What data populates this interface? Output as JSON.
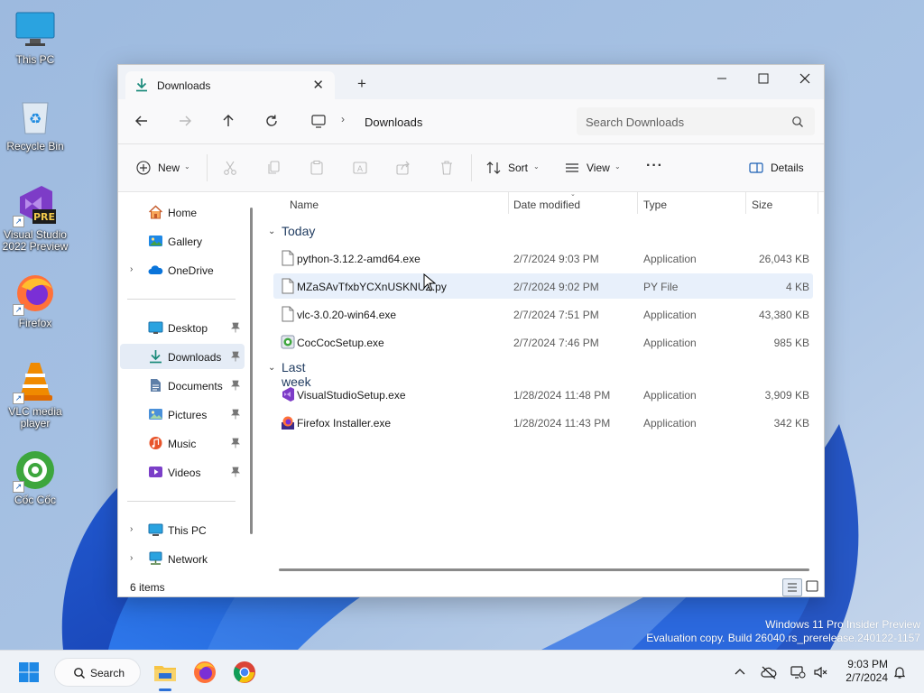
{
  "desktop": {
    "icons": [
      {
        "label": "This PC"
      },
      {
        "label": "Recycle Bin"
      },
      {
        "label": "Visual Studio 2022 Preview",
        "badge": "PRE"
      },
      {
        "label": "Firefox"
      },
      {
        "label": "VLC media player"
      },
      {
        "label": "Cốc Cốc"
      }
    ],
    "watermark": {
      "line1": "Windows 11 Pro Insider Preview",
      "line2": "Evaluation copy. Build 26040.rs_prerelease.240122-1157"
    }
  },
  "window": {
    "tab_title": "Downloads",
    "controls": {
      "minimize": "—",
      "maximize": "☐",
      "close": "✕"
    },
    "new_tab": "+",
    "nav": {
      "back": "←",
      "forward": "→",
      "up": "↑",
      "refresh": "↻"
    },
    "address": {
      "separator": "›",
      "current": "Downloads"
    },
    "search": {
      "placeholder": "Search Downloads"
    },
    "toolbar": {
      "new_label": "New",
      "sort_label": "Sort",
      "view_label": "View",
      "more_label": "···",
      "details_label": "Details"
    },
    "sidebar": {
      "items": [
        {
          "label": "Home",
          "icon": "home-icon"
        },
        {
          "label": "Gallery",
          "icon": "gallery-icon"
        },
        {
          "label": "OneDrive",
          "icon": "onedrive-icon"
        },
        {
          "label": "Desktop",
          "icon": "desktop-folder-icon"
        },
        {
          "label": "Downloads",
          "icon": "downloads-folder-icon"
        },
        {
          "label": "Documents",
          "icon": "documents-folder-icon"
        },
        {
          "label": "Pictures",
          "icon": "pictures-folder-icon"
        },
        {
          "label": "Music",
          "icon": "music-folder-icon"
        },
        {
          "label": "Videos",
          "icon": "videos-folder-icon"
        },
        {
          "label": "This PC",
          "icon": "this-pc-icon"
        },
        {
          "label": "Network",
          "icon": "network-icon"
        }
      ]
    },
    "columns": {
      "name": "Name",
      "date": "Date modified",
      "type": "Type",
      "size": "Size"
    },
    "groups": [
      {
        "label": "Today",
        "files": [
          {
            "name": "python-3.12.2-amd64.exe",
            "date": "2/7/2024 9:03 PM",
            "type": "Application",
            "size": "26,043 KB",
            "icon": "generic-file-icon"
          },
          {
            "name": "MZaSAvTfxbYCXnUSKNUZ.py",
            "date": "2/7/2024 9:02 PM",
            "type": "PY File",
            "size": "4 KB",
            "icon": "generic-file-icon"
          },
          {
            "name": "vlc-3.0.20-win64.exe",
            "date": "2/7/2024 7:51 PM",
            "type": "Application",
            "size": "43,380 KB",
            "icon": "generic-file-icon"
          },
          {
            "name": "CocCocSetup.exe",
            "date": "2/7/2024 7:46 PM",
            "type": "Application",
            "size": "985 KB",
            "icon": "coccoc-setup-icon"
          }
        ]
      },
      {
        "label": "Last week",
        "files": [
          {
            "name": "VisualStudioSetup.exe",
            "date": "1/28/2024 11:48 PM",
            "type": "Application",
            "size": "3,909 KB",
            "icon": "visual-studio-setup-icon"
          },
          {
            "name": "Firefox Installer.exe",
            "date": "1/28/2024 11:43 PM",
            "type": "Application",
            "size": "342 KB",
            "icon": "firefox-installer-icon"
          }
        ]
      }
    ],
    "status": {
      "item_count": "6 items"
    }
  },
  "taskbar": {
    "search_label": "Search",
    "clock": {
      "time": "9:03 PM",
      "date": "2/7/2024"
    }
  },
  "colors": {
    "accent": "#0067c0",
    "selection": "#e5ecf6",
    "hover": "#e8f0fb",
    "folder": "#f6c445"
  }
}
